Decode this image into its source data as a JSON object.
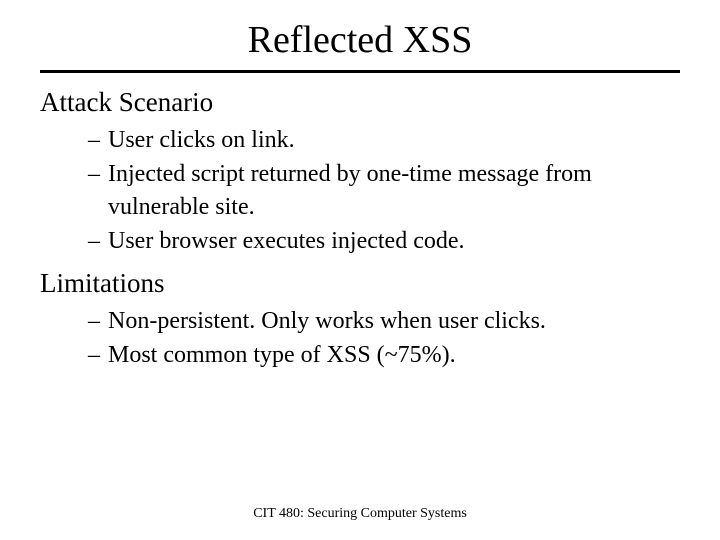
{
  "title": "Reflected XSS",
  "sections": [
    {
      "heading": "Attack Scenario",
      "items": [
        "User clicks on link.",
        "Injected script returned by one-time message from vulnerable site.",
        "User browser executes injected code."
      ]
    },
    {
      "heading": "Limitations",
      "items": [
        "Non-persistent.  Only works when user clicks.",
        "Most common type of XSS (~75%)."
      ]
    }
  ],
  "footer": "CIT 480: Securing Computer Systems"
}
